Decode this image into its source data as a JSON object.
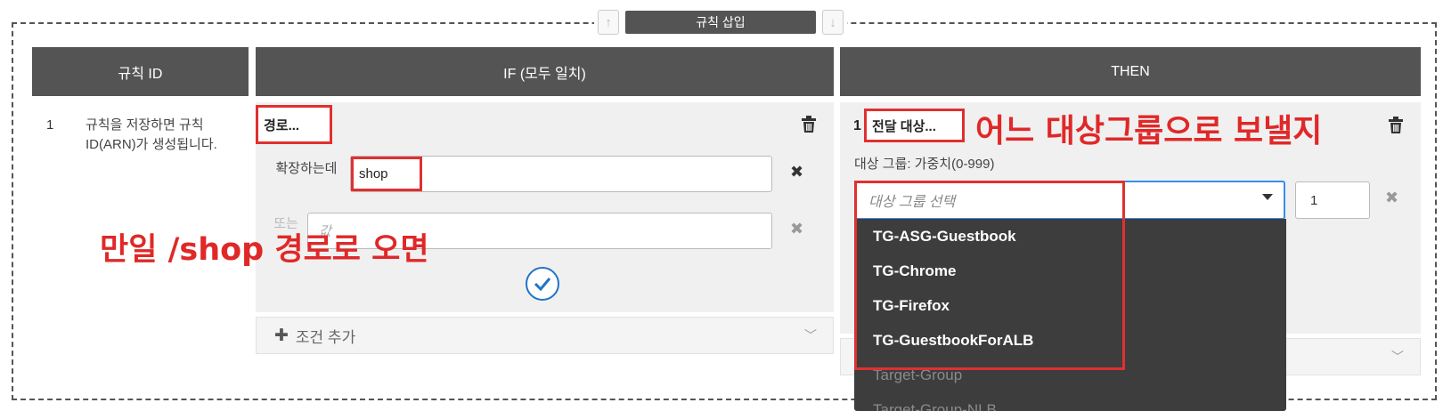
{
  "toolbar": {
    "up_arrow": "↑",
    "down_arrow": "↓",
    "insert_rule_label": "규칙 삽입"
  },
  "headers": {
    "rule_id": "규칙 ID",
    "if": "IF (모두 일치)",
    "then": "THEN"
  },
  "rule": {
    "number": "1",
    "description": "규칙을 저장하면 규칙 ID(ARN)가 생성됩니다."
  },
  "if_block": {
    "condition_type": "경로...",
    "value_label": "확장하는데",
    "value": "shop",
    "or_label": "또는",
    "or_placeholder": "값",
    "add_condition_label": "조건 추가",
    "icons": {
      "delete": "trash-icon",
      "remove": "close-icon",
      "confirm": "check-icon",
      "expand": "chevron-down-icon",
      "add": "plus-icon"
    }
  },
  "then_block": {
    "action_number": "1",
    "action_type": "전달 대상...",
    "target_group_label": "대상 그룹: 가중치(0-999)",
    "select_placeholder": "대상 그룹 선택",
    "weight_value": "1",
    "dropdown_options": [
      "TG-ASG-Guestbook",
      "TG-Chrome",
      "TG-Firefox",
      "TG-GuestbookForALB",
      "Target-Group",
      "Target-Group-NLB"
    ]
  },
  "annotations": {
    "then_note": "어느 대상그룹으로 보낼지",
    "if_note": "만일 /shop 경로로 오면"
  },
  "colors": {
    "header_bg": "#545454",
    "annotation_red": "#e02828",
    "focus_blue": "#3a8ee8",
    "dropdown_bg": "#3d3d3d"
  }
}
